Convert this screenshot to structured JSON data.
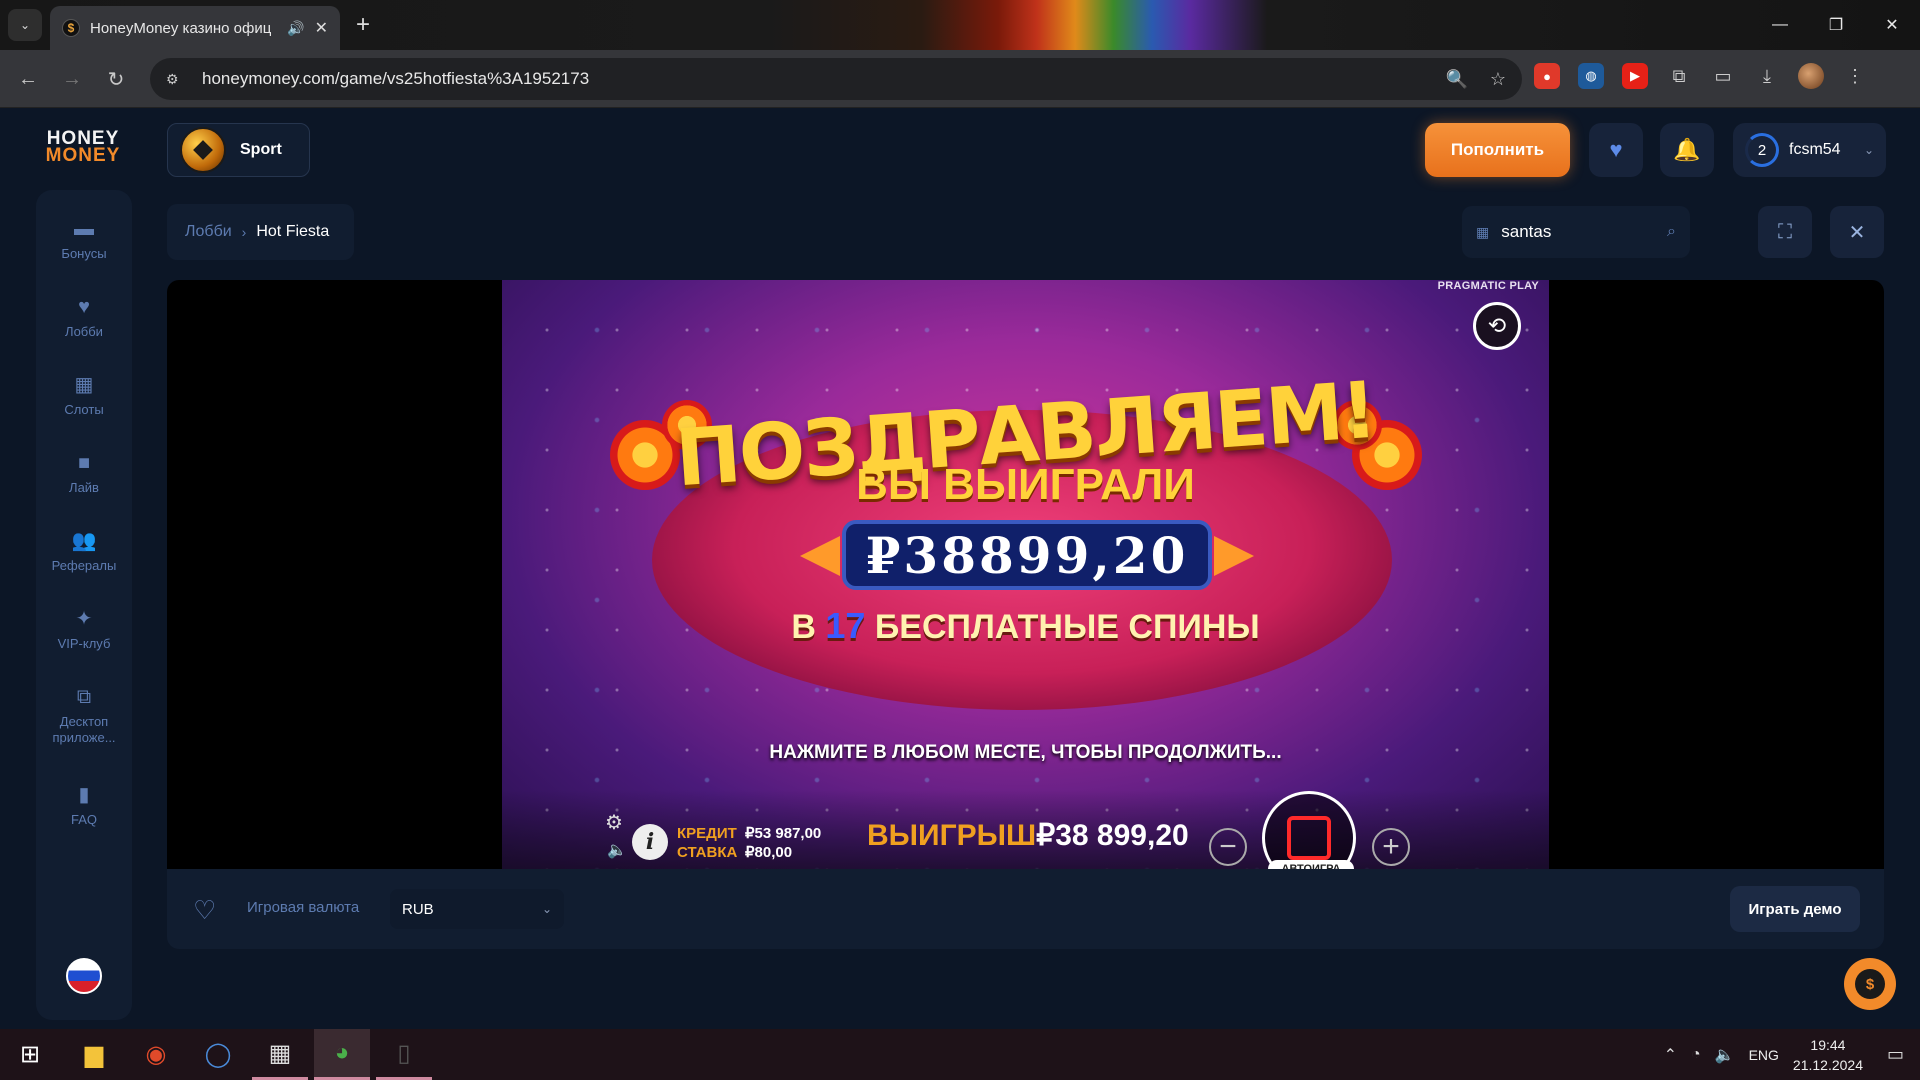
{
  "browser": {
    "tab_title": "HoneyMoney казино офиц",
    "url": "honeymoney.com/game/vs25hotfiesta%3A1952173"
  },
  "site": {
    "logo_line1": "HONEY",
    "logo_line2": "MONEY",
    "sport_label": "Sport",
    "deposit_label": "Пополнить",
    "user_level": "2",
    "username": "fcsm54",
    "breadcrumb": {
      "lobby": "Лобби",
      "current": "Hot Fiesta"
    },
    "search_value": "santas",
    "sidebar": [
      {
        "label": "Бонусы",
        "icon": "ticket-icon"
      },
      {
        "label": "Лобби",
        "icon": "heart-icon"
      },
      {
        "label": "Слоты",
        "icon": "grid-icon"
      },
      {
        "label": "Лайв",
        "icon": "video-icon"
      },
      {
        "label": "Рефералы",
        "icon": "users-icon"
      },
      {
        "label": "VIP-клуб",
        "icon": "sparkles-icon"
      },
      {
        "label": "Десктоп приложе...",
        "icon": "external-link-icon"
      },
      {
        "label": "FAQ",
        "icon": "document-icon"
      }
    ],
    "currency_label": "Игровая валюта",
    "currency_value": "RUB",
    "demo_label": "Играть демо"
  },
  "game": {
    "provider": "PRAGMATIC PLAY",
    "congrats": "ПОЗДРАВЛЯЕМ!",
    "you_won": "ВЫ ВЫИГРАЛИ",
    "win_amount": "₽38899,20",
    "free_spins_prefix": "В",
    "free_spins_count": "17",
    "free_spins_suffix": "БЕСПЛАТНЫЕ СПИНЫ",
    "continue_text": "НАЖМИТЕ В ЛЮБОМ МЕСТЕ, ЧТОБЫ ПРОДОЛЖИТЬ...",
    "credit_label": "КРЕДИТ",
    "credit_value": "₽53 987,00",
    "bet_label": "СТАВКА",
    "bet_value": "₽80,00",
    "win_label": "ВЫИГРЫШ",
    "win_value": "₽38 899,20",
    "autoplay_label": "АВТОИГРА"
  },
  "taskbar": {
    "lang": "ENG",
    "time": "19:44",
    "date": "21.12.2024"
  },
  "colors": {
    "accent": "#f28a2a",
    "bg": "#0c1626",
    "panel": "#111d30",
    "muted": "#5d7bb0"
  }
}
